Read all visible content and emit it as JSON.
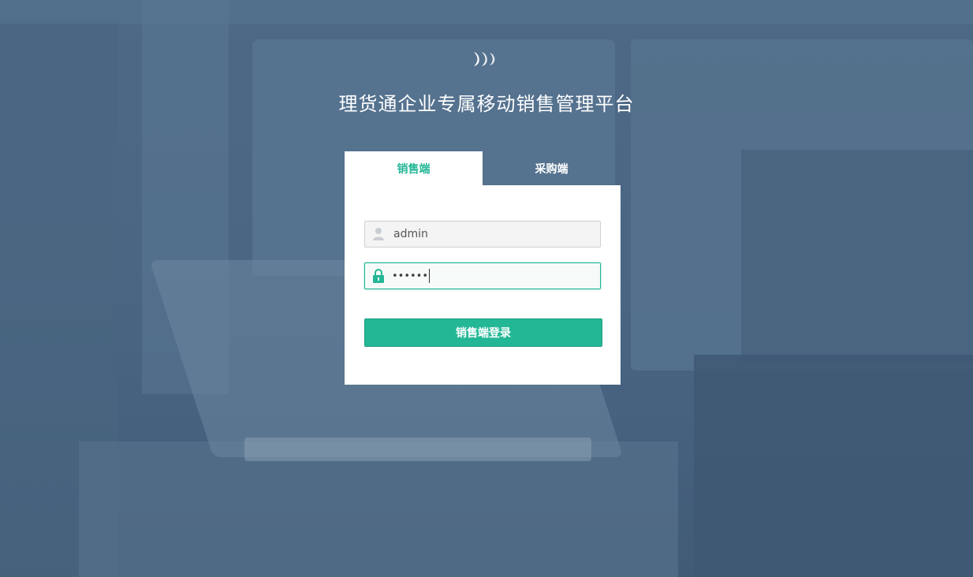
{
  "brand": {
    "logo_icon": "brand-logo-icon",
    "title": "理货通企业专属移动销售管理平台"
  },
  "tabs": [
    {
      "label": "销售端",
      "active": true
    },
    {
      "label": "采购端",
      "active": false
    }
  ],
  "login": {
    "username_value": "admin",
    "username_icon": "user-icon",
    "password_value": "••••••",
    "password_icon": "lock-icon",
    "submit_label": "销售端登录"
  },
  "colors": {
    "accent": "#24b796",
    "background": "#4a6682",
    "panel": "#ffffff"
  }
}
